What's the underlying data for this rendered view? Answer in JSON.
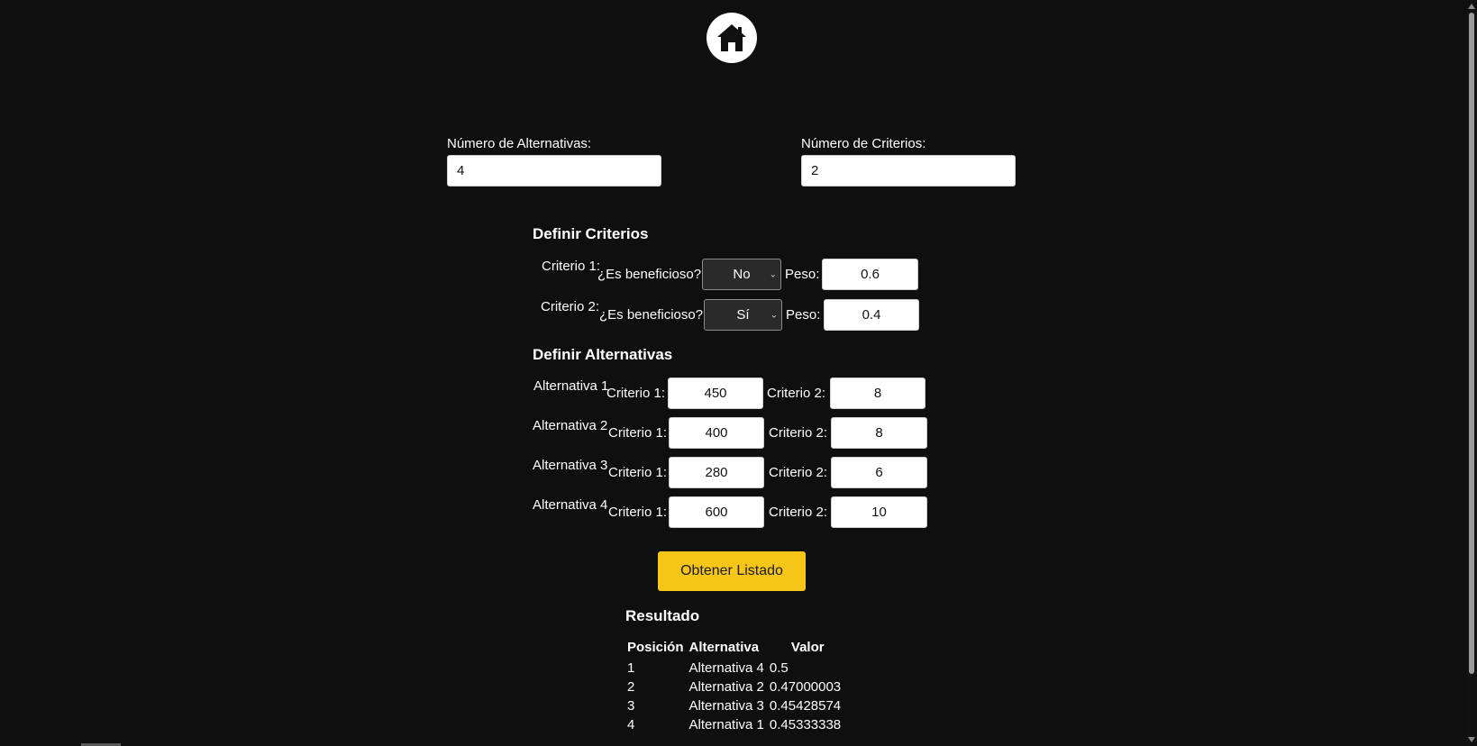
{
  "header": {
    "home_icon": "home-icon"
  },
  "top_fields": {
    "alternatives_label": "Número de Alternativas:",
    "alternatives_value": "4",
    "criteria_label": "Número de Criterios:",
    "criteria_value": "2"
  },
  "criteria_section": {
    "title": "Definir Criterios",
    "beneficial_label": "¿Es beneficioso?",
    "weight_label": "Peso:",
    "items": [
      {
        "label": "Criterio 1:",
        "beneficial": "No",
        "weight": "0.6"
      },
      {
        "label": "Criterio 2:",
        "beneficial": "Sí",
        "weight": "0.4"
      }
    ]
  },
  "alternatives_section": {
    "title": "Definir Alternativas",
    "crit1_label": "Criterio 1:",
    "crit2_label": "Criterio 2:",
    "items": [
      {
        "label": "Alternativa 1",
        "crit1": "450",
        "crit2": "8"
      },
      {
        "label": "Alternativa 2",
        "crit1": "400",
        "crit2": "8"
      },
      {
        "label": "Alternativa 3",
        "crit1": "280",
        "crit2": "6"
      },
      {
        "label": "Alternativa 4",
        "crit1": "600",
        "crit2": "10"
      }
    ]
  },
  "action": {
    "button_label": "Obtener Listado"
  },
  "result": {
    "title": "Resultado",
    "headers": [
      "Posición",
      "Alternativa",
      "Valor"
    ],
    "rows": [
      {
        "position": "1",
        "alternative": "Alternativa 4",
        "value": "0.5"
      },
      {
        "position": "2",
        "alternative": "Alternativa 2",
        "value": "0.47000003"
      },
      {
        "position": "3",
        "alternative": "Alternativa 3",
        "value": "0.45428574"
      },
      {
        "position": "4",
        "alternative": "Alternativa 1",
        "value": "0.45333338"
      }
    ]
  },
  "colors": {
    "background": "#0f0f0f",
    "button_accent": "#f5c518"
  }
}
